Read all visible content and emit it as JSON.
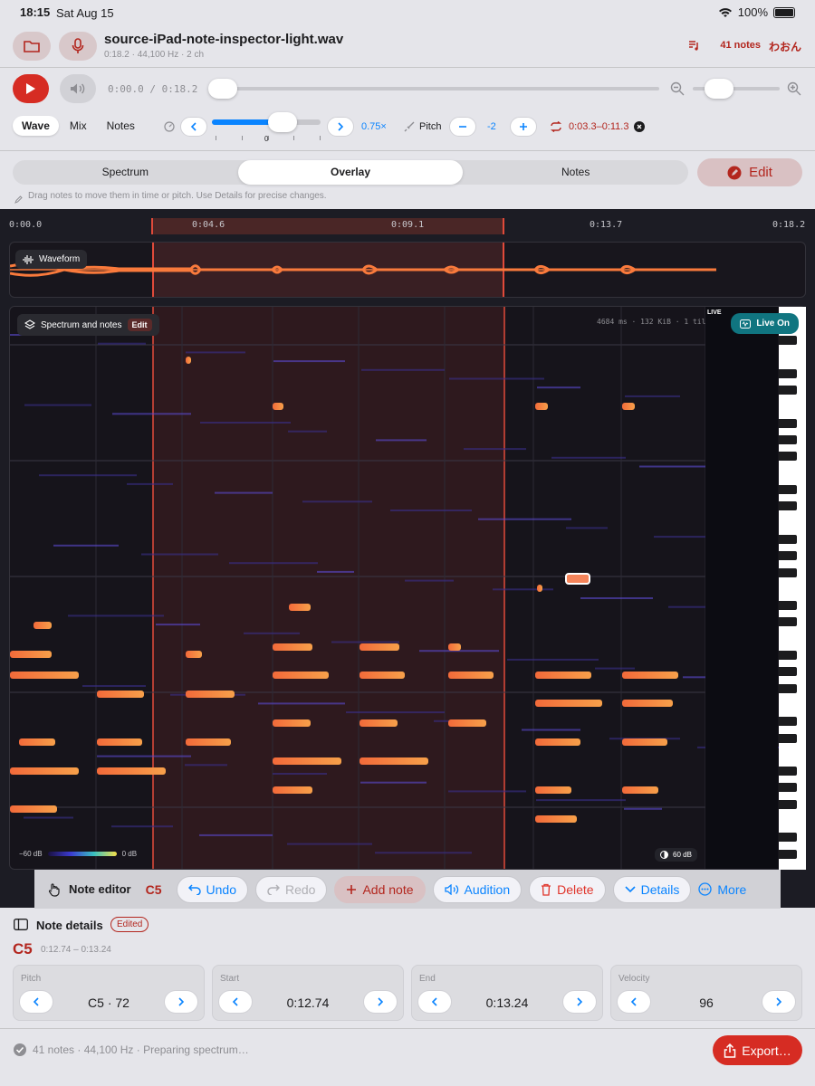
{
  "status_bar": {
    "time": "18:15",
    "date": "Sat Aug 15",
    "battery": "100%"
  },
  "header": {
    "file_name": "source-iPad-note-inspector-light.wav",
    "file_meta": "0:18.2 · 44,100 Hz · 2 ch",
    "notes_count": "41 notes",
    "extra_label": "わおん"
  },
  "transport": {
    "time_readout": "0:00.0 / 0:18.2",
    "playhead_fraction": 0.0,
    "zoom_fraction": 0.2
  },
  "controls": {
    "modes": [
      "Wave",
      "Mix",
      "Notes"
    ],
    "active_mode": "Wave",
    "speed": "0.75×",
    "speed_tick": "0",
    "pitch_label": "Pitch",
    "pitch_value": "-2",
    "loop_range": "0:03.3–0:11.3"
  },
  "views": {
    "tabs": [
      "Spectrum",
      "Overlay",
      "Notes"
    ],
    "active": "Overlay",
    "edit_label": "Edit"
  },
  "hint": "Drag notes to move them in time or pitch. Use Details for precise changes.",
  "timeline": {
    "ticks": [
      "0:00.0",
      "0:04.6",
      "0:09.1",
      "0:13.7",
      "0:18.2"
    ],
    "selection_start": "0:03.3",
    "selection_end": "0:11.3"
  },
  "waveform": {
    "label": "Waveform"
  },
  "spectrum": {
    "label": "Spectrum and notes",
    "edit_label": "Edit",
    "info": "4684 ms · 132 KiB · 1 til",
    "live_tag": "LIVE",
    "live_button": "Live On",
    "scale_min": "−60 dB",
    "scale_max": "0 dB",
    "gain": "60 dB"
  },
  "note_editor": {
    "title": "Note editor",
    "current_note": "C5",
    "undo": "Undo",
    "redo": "Redo",
    "add_note": "Add note",
    "audition": "Audition",
    "delete": "Delete",
    "details": "Details",
    "more": "More"
  },
  "details": {
    "title": "Note details",
    "badge": "Edited",
    "note": "C5",
    "range": "0:12.74 – 0:13.24",
    "fields": [
      {
        "label": "Pitch",
        "value": "C5 · 72"
      },
      {
        "label": "Start",
        "value": "0:12.74"
      },
      {
        "label": "End",
        "value": "0:13.24"
      },
      {
        "label": "Velocity",
        "value": "96"
      }
    ]
  },
  "footer": {
    "status": "41 notes · 44,100 Hz · Preparing spectrum…",
    "export": "Export…"
  },
  "colors": {
    "accent_red": "#d62c23",
    "accent_blue": "#0a84ff",
    "note_orange": "#f97a3c",
    "live_teal": "#107580"
  }
}
